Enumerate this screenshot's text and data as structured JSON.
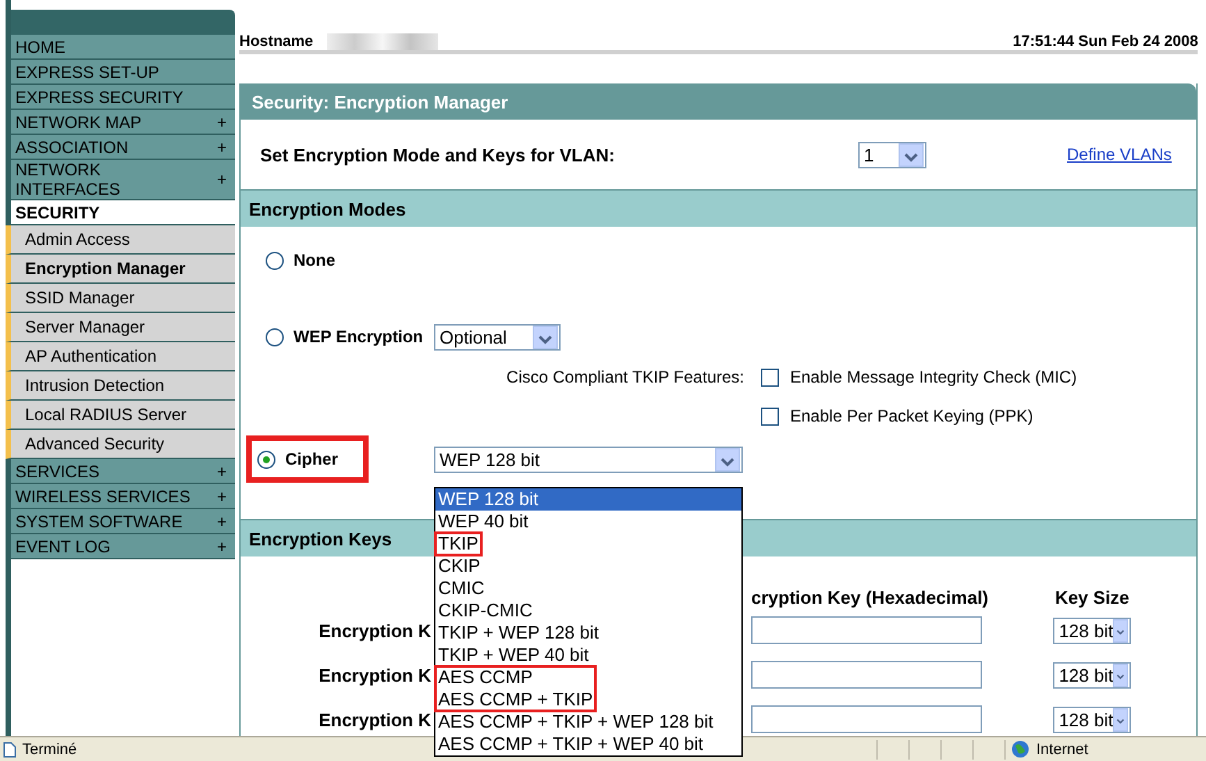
{
  "sidebar": {
    "items": [
      {
        "label": "HOME",
        "selected": false
      },
      {
        "label": "EXPRESS SET-UP",
        "selected": false
      },
      {
        "label": "EXPRESS SECURITY",
        "selected": false
      },
      {
        "label": "NETWORK MAP",
        "expander": "+",
        "selected": false
      },
      {
        "label": "ASSOCIATION",
        "expander": "+",
        "selected": false
      },
      {
        "label": "NETWORK INTERFACES",
        "expander": "+",
        "selected": false
      },
      {
        "label": "SECURITY",
        "selected": true,
        "children": [
          {
            "label": "Admin Access",
            "selected": false
          },
          {
            "label": "Encryption Manager",
            "selected": true
          },
          {
            "label": "SSID Manager",
            "selected": false
          },
          {
            "label": "Server Manager",
            "selected": false
          },
          {
            "label": "AP Authentication",
            "selected": false
          },
          {
            "label": "Intrusion Detection",
            "selected": false
          },
          {
            "label": "Local RADIUS Server",
            "selected": false
          },
          {
            "label": "Advanced Security",
            "selected": false
          }
        ]
      },
      {
        "label": "SERVICES",
        "expander": "+",
        "selected": false
      },
      {
        "label": "WIRELESS SERVICES",
        "expander": "+",
        "selected": false
      },
      {
        "label": "SYSTEM SOFTWARE",
        "expander": "+",
        "selected": false
      },
      {
        "label": "EVENT LOG",
        "expander": "+",
        "selected": false
      }
    ]
  },
  "header": {
    "hostname_label": "Hostname",
    "clock": "17:51:44 Sun Feb 24 2008"
  },
  "panel": {
    "title": "Security: Encryption Manager",
    "vlan": {
      "label": "Set Encryption Mode and Keys for VLAN:",
      "value": "1",
      "link": "Define VLANs"
    },
    "modes_heading": "Encryption Modes",
    "modes": [
      {
        "label": "None",
        "selected": false,
        "highlighted": false
      },
      {
        "label": "WEP Encryption",
        "selected": false,
        "highlighted": false,
        "select": "Optional",
        "features": {
          "label": "Cisco Compliant TKIP Features:",
          "options": [
            {
              "label": "Enable Message Integrity Check (MIC)",
              "checked": false
            },
            {
              "label": "Enable Per Packet Keying (PPK)",
              "checked": false
            }
          ]
        }
      },
      {
        "label": "Cipher",
        "selected": true,
        "highlighted": true,
        "select": "WEP 128 bit"
      }
    ],
    "keys_heading": "Encryption Keys",
    "key_columns": [
      "cryption Key (Hexadecimal)",
      "Key Size"
    ],
    "key_rows": [
      {
        "label": "Encryption K",
        "key_size": "128 bit"
      },
      {
        "label": "Encryption K",
        "key_size": "128 bit"
      },
      {
        "label": "Encryption K",
        "key_size": "128 bit"
      }
    ]
  },
  "cipher_dropdown": {
    "groups": [
      {
        "highlighted": false,
        "options": [
          {
            "label": "WEP 128 bit",
            "selected": true
          },
          {
            "label": "WEP 40 bit",
            "selected": false
          }
        ]
      },
      {
        "highlighted": true,
        "options": [
          {
            "label": "TKIP",
            "selected": false
          }
        ]
      },
      {
        "highlighted": false,
        "options": [
          {
            "label": "CKIP",
            "selected": false
          },
          {
            "label": "CMIC",
            "selected": false
          },
          {
            "label": "CKIP-CMIC",
            "selected": false
          },
          {
            "label": "TKIP + WEP 128 bit",
            "selected": false
          },
          {
            "label": "TKIP + WEP 40 bit",
            "selected": false
          }
        ]
      },
      {
        "highlighted": true,
        "options": [
          {
            "label": "AES CCMP",
            "selected": false
          },
          {
            "label": "AES CCMP + TKIP",
            "selected": false
          }
        ]
      },
      {
        "highlighted": false,
        "options": [
          {
            "label": "AES CCMP + TKIP + WEP 128 bit",
            "selected": false
          },
          {
            "label": "AES CCMP + TKIP + WEP 40 bit",
            "selected": false
          }
        ]
      }
    ]
  },
  "status_bar": {
    "status": "Terminé",
    "zone": "Internet"
  }
}
